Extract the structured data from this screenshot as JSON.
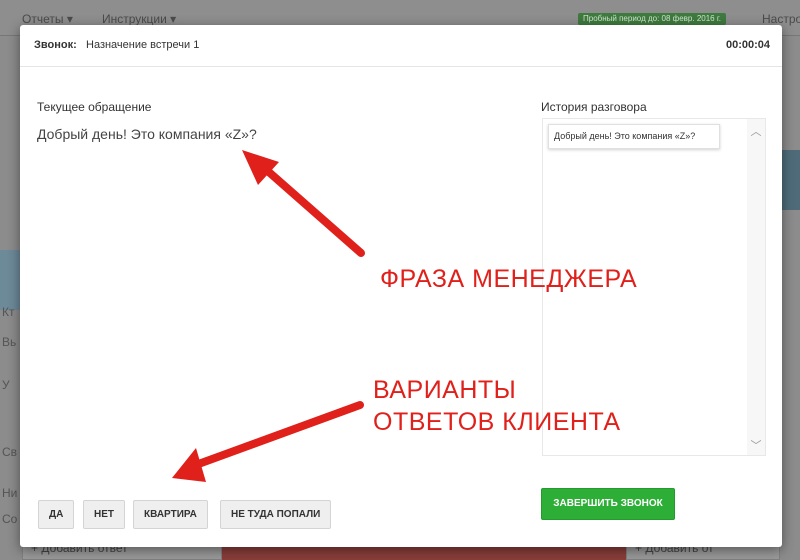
{
  "background": {
    "menu": [
      {
        "label": "Отчеты ▾"
      },
      {
        "label": "Инструкции ▾"
      }
    ],
    "trial_badge": "Пробный период до: 08 февр. 2016 г.",
    "right_menu": "Настро",
    "bottom_left_button": "+ Добавить ответ",
    "bottom_right_button": "+ Добавить от",
    "left_fragments": [
      "Кт",
      "Вь",
      "У",
      "Св",
      "Ни",
      "Со"
    ]
  },
  "modal": {
    "header": {
      "label": "Звонок:",
      "title": "Назначение встречи 1",
      "timer": "00:00:04"
    },
    "current": {
      "label": "Текущее обращение",
      "text": "Добрый день! Это компания «Z»?"
    },
    "history": {
      "label": "История разговора",
      "items": [
        "Добрый день! Это компания «Z»?"
      ]
    },
    "answers": [
      {
        "label": "ДА"
      },
      {
        "label": "НЕТ"
      },
      {
        "label": "КВАРТИРА"
      },
      {
        "label": "НЕ ТУДА ПОПАЛИ"
      }
    ],
    "end_call_label": "ЗАВЕРШИТЬ ЗВОНОК"
  },
  "annotations": {
    "manager_phrase": "ФРАЗА МЕНЕДЖЕРА",
    "client_answers_line1": "ВАРИАНТЫ",
    "client_answers_line2": "ОТВЕТОВ КЛИЕНТА"
  },
  "colors": {
    "accent_green": "#2dae36",
    "annotation_red": "#e0201a"
  }
}
